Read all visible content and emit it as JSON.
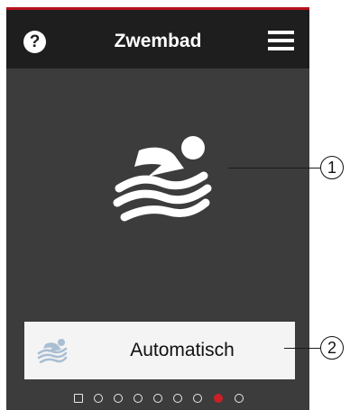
{
  "header": {
    "help_label": "?",
    "title": "Zwembad",
    "help_icon": "question-circle-icon",
    "menu_icon": "hamburger-menu-icon"
  },
  "main": {
    "hero_icon": "swimmer-icon",
    "mode_button": {
      "icon": "swimmer-icon",
      "label": "Automatisch"
    }
  },
  "pager": {
    "page_count": 9,
    "current_page": 8
  },
  "callouts": [
    "1",
    "2"
  ],
  "colors": {
    "header_bg": "#1e1e1e",
    "screen_bg": "#3c3c3c",
    "accent": "#b5121b",
    "active_dot": "#cc1f26",
    "button_bg": "#f4f4f4",
    "mini_icon": "#a9bfd3"
  }
}
